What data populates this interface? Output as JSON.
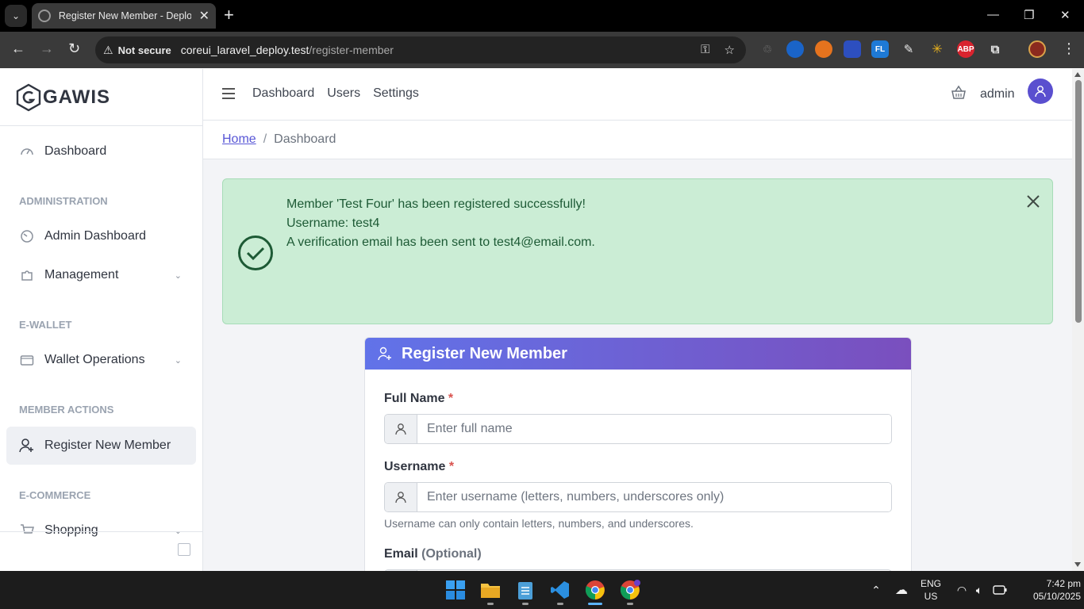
{
  "browser": {
    "tab_title": "Register New Member - Deploy",
    "security_label": "Not secure",
    "url_host": "coreui_laravel_deploy.test",
    "url_path": "/register-member",
    "extensions": [
      {
        "name": "abp",
        "label": "ABP",
        "color": "#d9232e"
      },
      {
        "name": "fl",
        "label": "FL",
        "color": "#1e7ad6"
      }
    ]
  },
  "sidebar": {
    "brand": "GAWIS",
    "items": [
      {
        "label": "Dashboard"
      },
      {
        "section": "ADMINISTRATION"
      },
      {
        "label": "Admin Dashboard"
      },
      {
        "label": "Management"
      },
      {
        "section": "E-WALLET"
      },
      {
        "label": "Wallet Operations"
      },
      {
        "section": "MEMBER ACTIONS"
      },
      {
        "label": "Register New Member"
      },
      {
        "section": "E-COMMERCE"
      },
      {
        "label": "Shopping"
      }
    ]
  },
  "header": {
    "nav": [
      "Dashboard",
      "Users",
      "Settings"
    ],
    "user": "admin"
  },
  "breadcrumb": {
    "home": "Home",
    "current": "Dashboard"
  },
  "alert": {
    "line1": "Member 'Test Four' has been registered successfully!",
    "line2": "Username: test4",
    "line3": "A verification email has been sent to test4@email.com.",
    "color": "#cbedd5"
  },
  "form": {
    "title": "Register New Member",
    "fullname_label": "Full Name",
    "fullname_placeholder": "Enter full name",
    "username_label": "Username",
    "username_placeholder": "Enter username (letters, numbers, underscores only)",
    "username_help": "Username can only contain letters, numbers, and underscores.",
    "email_label": "Email",
    "email_optional": "(Optional)",
    "required_mark": "*"
  },
  "taskbar": {
    "lang": "ENG",
    "region": "US",
    "time": "7:42 pm",
    "date": "05/10/2025"
  }
}
